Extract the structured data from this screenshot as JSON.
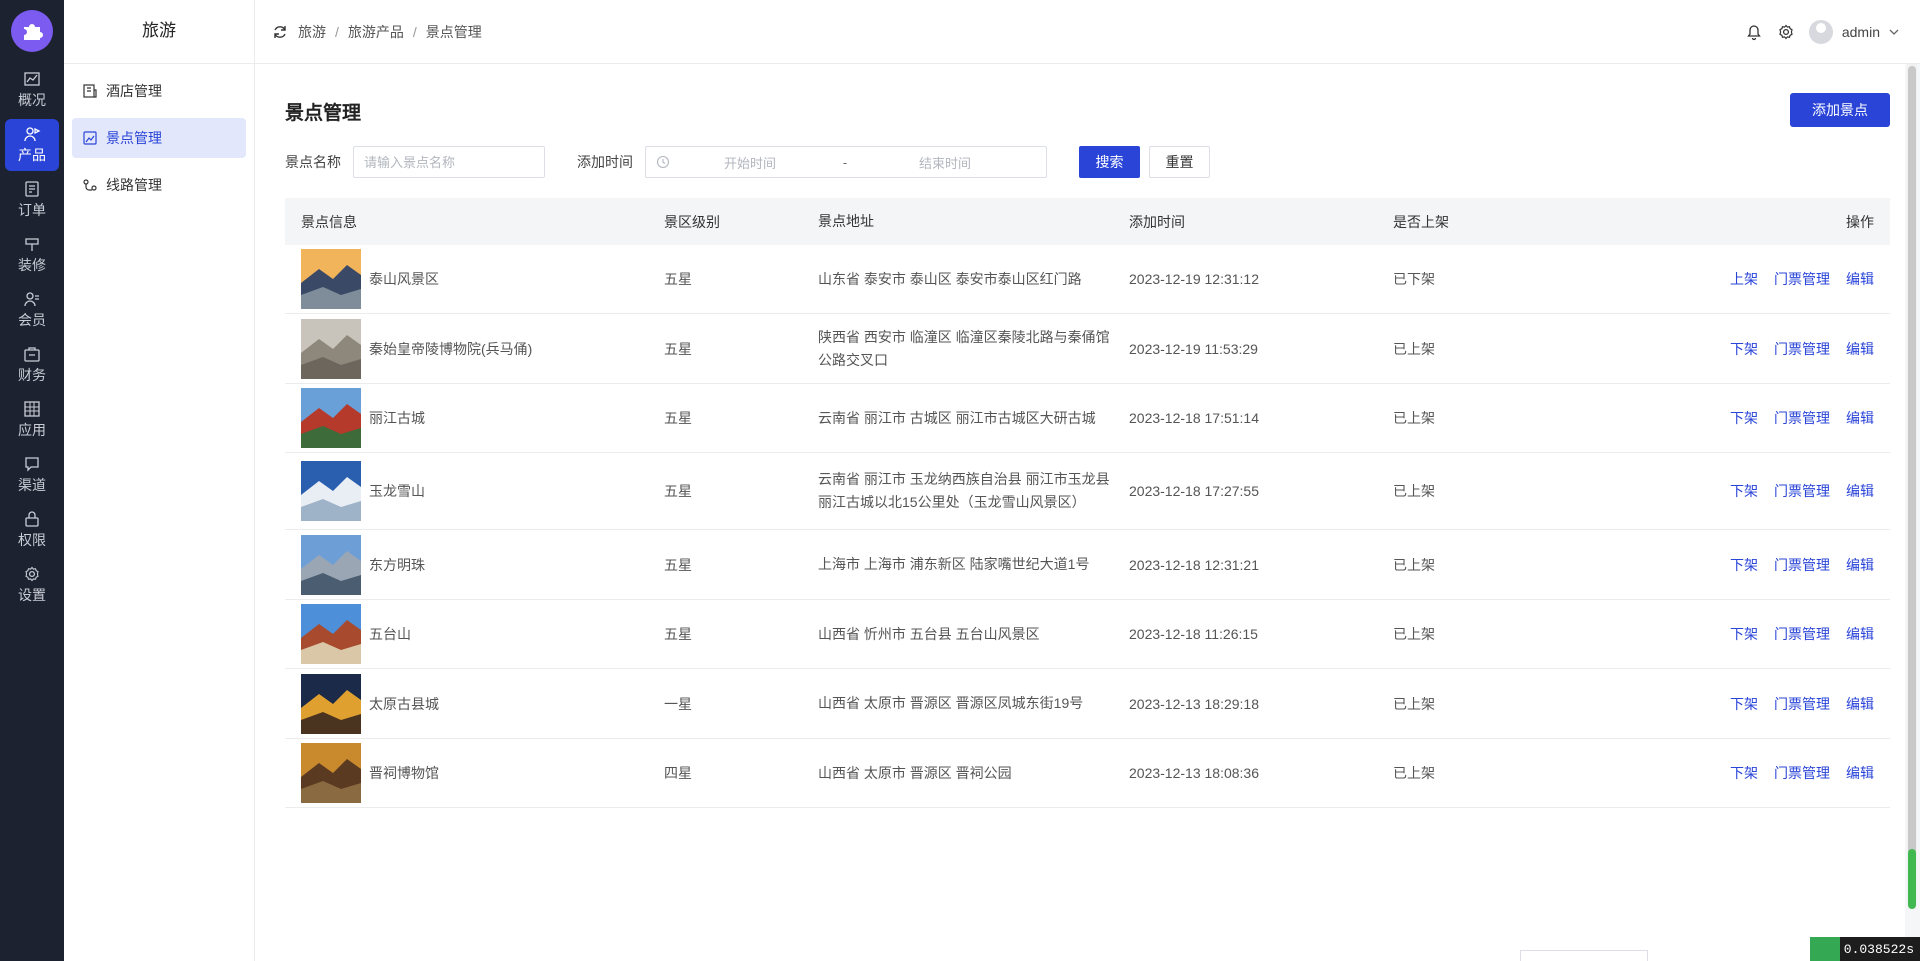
{
  "rail": {
    "items": [
      {
        "label": "概况",
        "icon": "chart-icon",
        "active": false
      },
      {
        "label": "产品",
        "icon": "product-icon",
        "active": true
      },
      {
        "label": "订单",
        "icon": "order-icon",
        "active": false
      },
      {
        "label": "装修",
        "icon": "decorate-icon",
        "active": false
      },
      {
        "label": "会员",
        "icon": "member-icon",
        "active": false
      },
      {
        "label": "财务",
        "icon": "finance-icon",
        "active": false
      },
      {
        "label": "应用",
        "icon": "apps-icon",
        "active": false
      },
      {
        "label": "渠道",
        "icon": "channel-icon",
        "active": false
      },
      {
        "label": "权限",
        "icon": "lock-icon",
        "active": false
      },
      {
        "label": "设置",
        "icon": "gear-icon",
        "active": false
      }
    ]
  },
  "subnav": {
    "title": "旅游",
    "items": [
      {
        "label": "酒店管理",
        "icon": "hotel-icon",
        "active": false
      },
      {
        "label": "景点管理",
        "icon": "scenic-icon",
        "active": true
      },
      {
        "label": "线路管理",
        "icon": "route-icon",
        "active": false
      }
    ]
  },
  "header": {
    "breadcrumbs": [
      "旅游",
      "旅游产品",
      "景点管理"
    ],
    "username": "admin"
  },
  "page": {
    "title": "景点管理",
    "add_button": "添加景点"
  },
  "filter": {
    "name_label": "景点名称",
    "name_placeholder": "请输入景点名称",
    "time_label": "添加时间",
    "start_placeholder": "开始时间",
    "range_sep": "-",
    "end_placeholder": "结束时间",
    "search_button": "搜索",
    "reset_button": "重置"
  },
  "table": {
    "columns": [
      "景点信息",
      "景区级别",
      "景点地址",
      "添加时间",
      "是否上架",
      "操作"
    ],
    "actions": {
      "ticket": "门票管理",
      "edit": "编辑"
    },
    "rows": [
      {
        "name": "泰山风景区",
        "level": "五星",
        "address": "山东省 泰安市 泰山区 泰安市泰山区红门路",
        "time": "2023-12-19 12:31:12",
        "status": "已下架",
        "toggle": "上架",
        "thumb": [
          "#f2b45a",
          "#3a4a66",
          "#7f8c9a"
        ]
      },
      {
        "name": "秦始皇帝陵博物院(兵马俑)",
        "level": "五星",
        "address": "陕西省 西安市 临潼区 临潼区秦陵北路与秦俑馆公路交叉口",
        "time": "2023-12-19 11:53:29",
        "status": "已上架",
        "toggle": "下架",
        "thumb": [
          "#c8c4bc",
          "#8d877c",
          "#6d665c"
        ]
      },
      {
        "name": "丽江古城",
        "level": "五星",
        "address": "云南省 丽江市 古城区 丽江市古城区大研古城",
        "time": "2023-12-18 17:51:14",
        "status": "已上架",
        "toggle": "下架",
        "thumb": [
          "#6aa0d8",
          "#b63a2c",
          "#3e6b3a"
        ]
      },
      {
        "name": "玉龙雪山",
        "level": "五星",
        "address": "云南省 丽江市 玉龙纳西族自治县 丽江市玉龙县丽江古城以北15公里处（玉龙雪山风景区）",
        "time": "2023-12-18 17:27:55",
        "status": "已上架",
        "toggle": "下架",
        "thumb": [
          "#2a5fb0",
          "#e8eef4",
          "#9fb3c8"
        ]
      },
      {
        "name": "东方明珠",
        "level": "五星",
        "address": "上海市 上海市 浦东新区 陆家嘴世纪大道1号",
        "time": "2023-12-18 12:31:21",
        "status": "已上架",
        "toggle": "下架",
        "thumb": [
          "#6d9fd6",
          "#9aa6b4",
          "#4b5d70"
        ]
      },
      {
        "name": "五台山",
        "level": "五星",
        "address": "山西省 忻州市 五台县 五台山风景区",
        "time": "2023-12-18 11:26:15",
        "status": "已上架",
        "toggle": "下架",
        "thumb": [
          "#4d8fd8",
          "#a84a2e",
          "#d9c7a8"
        ]
      },
      {
        "name": "太原古县城",
        "level": "一星",
        "address": "山西省 太原市 晋源区 晋源区凤城东街19号",
        "time": "2023-12-13 18:29:18",
        "status": "已上架",
        "toggle": "下架",
        "thumb": [
          "#1a2a48",
          "#e0a030",
          "#4a3420"
        ]
      },
      {
        "name": "晋祠博物馆",
        "level": "四星",
        "address": "山西省 太原市 晋源区 晋祠公园",
        "time": "2023-12-13 18:08:36",
        "status": "已上架",
        "toggle": "下架",
        "thumb": [
          "#c98a2e",
          "#5b3a22",
          "#8a6a40"
        ]
      }
    ]
  },
  "timing": "0.038522s",
  "colors": {
    "primary": "#2a44d8",
    "rail_bg": "#1d2230",
    "logo": "#7b5bf0"
  }
}
